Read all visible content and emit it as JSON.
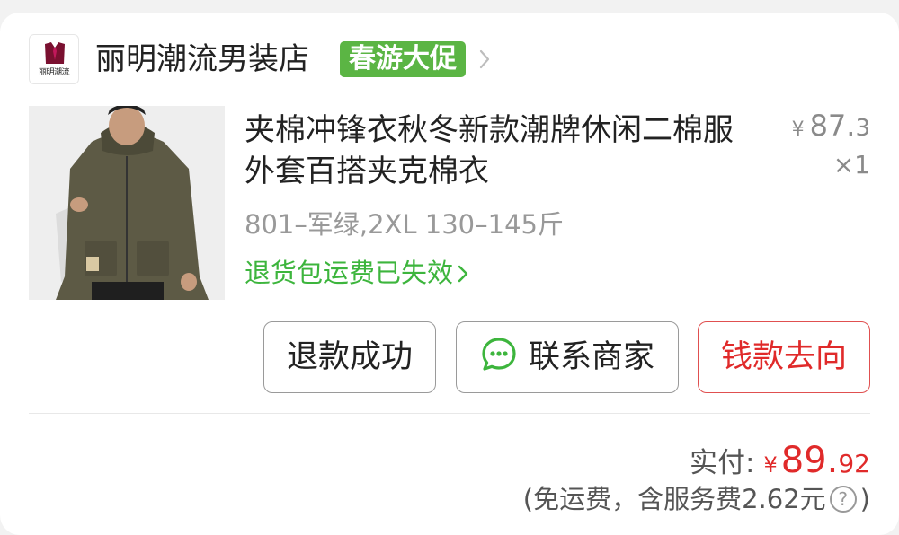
{
  "shop": {
    "logo_text": "丽明潮流",
    "name": "丽明潮流男装店",
    "promo_badge": "春游大促"
  },
  "product": {
    "title": "夹棉冲锋衣秋冬新款潮牌休闲二棉服外套百搭夹克棉衣",
    "price_symbol": "¥",
    "price_int": "87.",
    "price_dec": "3",
    "quantity": "×1",
    "spec": "801–军绿,2XL 130–145斤",
    "insurance": "退货包运费已失效"
  },
  "actions": {
    "refund_label": "退款成功",
    "contact_label": "联系商家",
    "money_label": "钱款去向"
  },
  "payment": {
    "paid_label": "实付:",
    "symbol": "¥",
    "amount_int": "89.",
    "amount_dec": "92",
    "fee_prefix": "(免运费，含服务费2.62元",
    "fee_suffix": ")"
  },
  "colors": {
    "accent_green": "#3db53d",
    "promo_green": "#5bb544",
    "price_red": "#e02a2a"
  },
  "icons": {
    "shop_logo": "suit-tie-logo",
    "chevron": "chevron-right-icon",
    "chat": "chat-bubble-icon",
    "help": "question-circle-icon"
  }
}
